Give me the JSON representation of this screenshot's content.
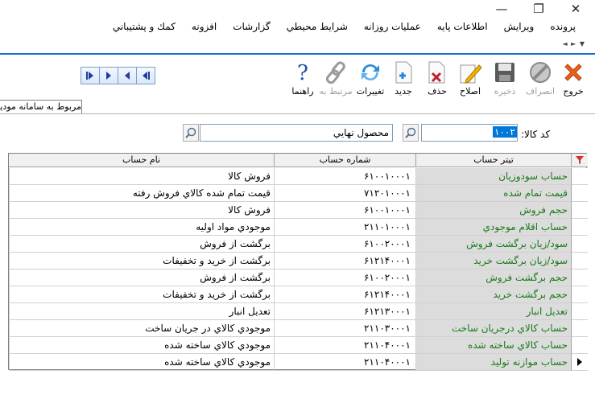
{
  "window_controls": {
    "minimize": "—",
    "maximize": "❐",
    "close": "✕"
  },
  "menu": [
    "پرونده",
    "ويرايش",
    "اطلاعات پايه",
    "عمليات روزانه",
    "شرايط محيطي",
    "گزارشات",
    "افزونه",
    "كمك و پشتيباني"
  ],
  "toolbar": [
    {
      "label": "خروج",
      "icon": "exit-x-icon",
      "enabled": true
    },
    {
      "label": "انصراف",
      "icon": "cancel-icon",
      "enabled": false
    },
    {
      "label": "ذخيره",
      "icon": "save-disk-icon",
      "enabled": false
    },
    {
      "label": "اصلاح",
      "icon": "edit-pencil-icon",
      "enabled": true
    },
    {
      "label": "حذف",
      "icon": "delete-doc-icon",
      "enabled": true
    },
    {
      "label": "جديد",
      "icon": "new-doc-icon",
      "enabled": true
    },
    {
      "label": "تغييرات",
      "icon": "refresh-icon",
      "enabled": true
    },
    {
      "label": "مرتبط به",
      "icon": "link-icon",
      "enabled": false
    },
    {
      "label": "راهنما",
      "icon": "help-icon",
      "enabled": true
    }
  ],
  "tab": {
    "label": "مربوط به سامانه مودیان"
  },
  "form": {
    "code_label": "كد كالا:",
    "code_value": "۱۰۰۲",
    "product_value": "محصول نهايي"
  },
  "grid": {
    "columns": {
      "title": "تيتر حساب",
      "number": "شماره حساب",
      "name": "نام حساب"
    },
    "rows": [
      {
        "title": "حساب سودوزيان",
        "number": "۶۱۰۰۱۰۰۰۱",
        "name": "فروش كالا"
      },
      {
        "title": "قيمت تمام شده",
        "number": "۷۱۲۰۱۰۰۰۱",
        "name": "قيمت تمام شده كالاي فروش رفته"
      },
      {
        "title": "حجم فروش",
        "number": "۶۱۰۰۱۰۰۰۱",
        "name": "فروش كالا"
      },
      {
        "title": "حساب اقلام موجودي",
        "number": "۲۱۱۰۱۰۰۰۱",
        "name": "موجودي مواد اوليه"
      },
      {
        "title": "سود/زيان برگشت فروش",
        "number": "۶۱۰۰۲۰۰۰۱",
        "name": "برگشت از فروش"
      },
      {
        "title": "سود/زيان برگشت خريد",
        "number": "۶۱۲۱۴۰۰۰۱",
        "name": "برگشت از خريد و تخفيفات"
      },
      {
        "title": "حجم برگشت فروش",
        "number": "۶۱۰۰۲۰۰۰۱",
        "name": "برگشت از فروش"
      },
      {
        "title": "حجم برگشت خريد",
        "number": "۶۱۲۱۴۰۰۰۱",
        "name": "برگشت از خريد و تخفيفات"
      },
      {
        "title": "تعديل انبار",
        "number": "۶۱۲۱۳۰۰۰۱",
        "name": "تعديل انبار"
      },
      {
        "title": "حساب كالاي درجريان ساخت",
        "number": "۲۱۱۰۳۰۰۰۱",
        "name": "موجودي كالاي در جريان ساخت"
      },
      {
        "title": "حساب كالاي ساخته شده",
        "number": "۲۱۱۰۴۰۰۰۱",
        "name": "موجودي كالاي ساخته شده"
      },
      {
        "title": "حساب موازنه توليد",
        "number": "۲۱۱۰۴۰۰۰۱",
        "name": "موجودي كالاي ساخته شده",
        "current": true
      }
    ]
  },
  "colors": {
    "accent_line": "#1a73c9",
    "title_text": "#1a7a1a",
    "title_bg": "#dcdcdc",
    "selection": "#0078d7",
    "filter_icon": "#d32f2f"
  }
}
